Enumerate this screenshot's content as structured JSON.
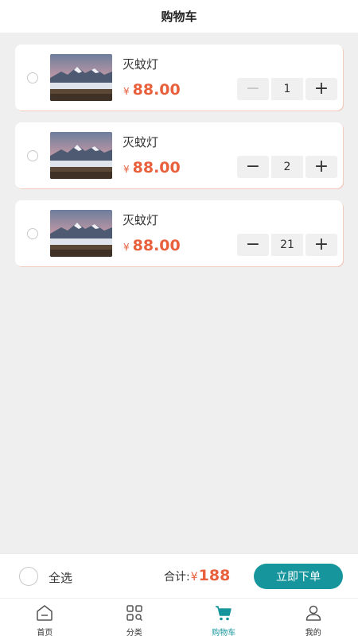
{
  "header": {
    "title": "购物车"
  },
  "cart": {
    "items": [
      {
        "name": "灭蚊灯",
        "currency": "¥",
        "price": "88.00",
        "quantity": "1",
        "decrement": "−",
        "increment": "+",
        "decrement_disabled": true
      },
      {
        "name": "灭蚊灯",
        "currency": "¥",
        "price": "88.00",
        "quantity": "2",
        "decrement": "−",
        "increment": "+",
        "decrement_disabled": false
      },
      {
        "name": "灭蚊灯",
        "currency": "¥",
        "price": "88.00",
        "quantity": "21",
        "decrement": "−",
        "increment": "+",
        "decrement_disabled": false
      }
    ]
  },
  "checkout": {
    "select_all_label": "全选",
    "total_label": "合计:",
    "total_currency": "¥",
    "total_amount": "188",
    "order_button_label": "立即下单"
  },
  "tabbar": {
    "home": "首页",
    "category": "分类",
    "cart": "购物车",
    "mine": "我的"
  },
  "colors": {
    "accent": "#16969c",
    "price": "#e8603c"
  }
}
